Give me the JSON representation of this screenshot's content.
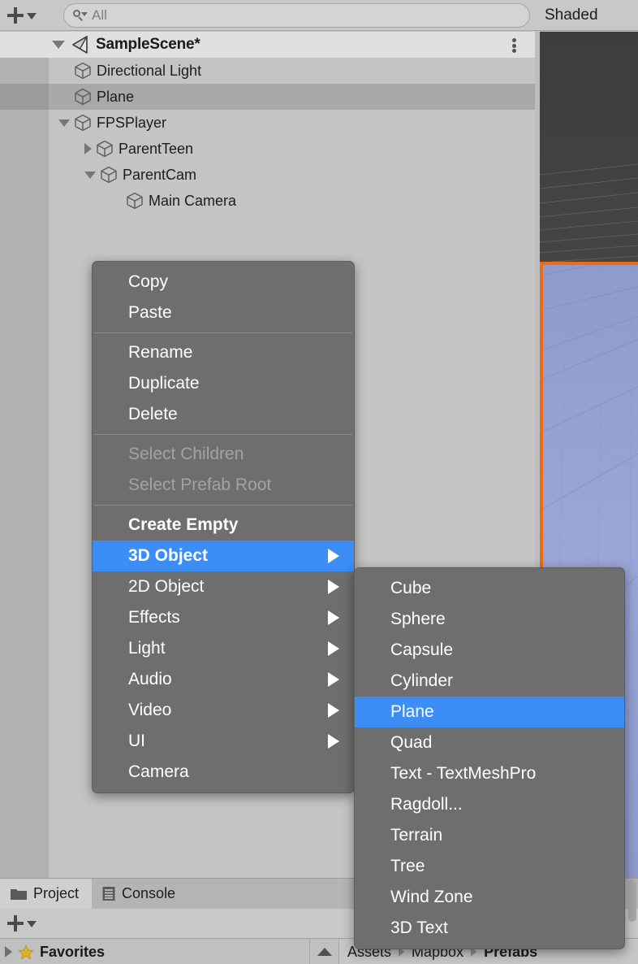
{
  "app": "Unity Editor",
  "hierarchy": {
    "toolbar": {
      "add_label": "+",
      "add_dropdown_icon": "chevron-down-icon",
      "search_icon": "search-icon",
      "search_value": "All",
      "search_placeholder": "All"
    },
    "scene": {
      "name": "SampleScene*",
      "icon": "unity-scene-icon",
      "expanded": true,
      "options_icon": "kebab-menu-icon"
    },
    "items": [
      {
        "label": "Directional Light",
        "depth": 1,
        "foldout": "none",
        "icon": "gameobject-cube-icon",
        "selected": false,
        "zebra": false
      },
      {
        "label": "Plane",
        "depth": 1,
        "foldout": "none",
        "icon": "gameobject-cube-icon",
        "selected": true,
        "zebra": false
      },
      {
        "label": "FPSPlayer",
        "depth": 1,
        "foldout": "open",
        "icon": "gameobject-cube-icon",
        "selected": false,
        "zebra": false
      },
      {
        "label": "ParentTeen",
        "depth": 2,
        "foldout": "closed",
        "icon": "gameobject-cube-icon",
        "selected": false,
        "zebra": false
      },
      {
        "label": "ParentCam",
        "depth": 2,
        "foldout": "open",
        "icon": "gameobject-cube-icon",
        "selected": false,
        "zebra": false
      },
      {
        "label": "Main Camera",
        "depth": 3,
        "foldout": "none",
        "icon": "gameobject-cube-icon",
        "selected": false,
        "zebra": false
      }
    ]
  },
  "scene_view": {
    "shading_mode": "Shaded",
    "sky_color": "#3c3c3c",
    "ground_color": "#93a0d2",
    "selection_outline_color": "#ef6a18"
  },
  "context_menu": {
    "groups": [
      {
        "items": [
          {
            "label": "Copy",
            "disabled": false,
            "submenu": false,
            "highlight": false,
            "bold": false
          },
          {
            "label": "Paste",
            "disabled": false,
            "submenu": false,
            "highlight": false,
            "bold": false
          }
        ]
      },
      {
        "items": [
          {
            "label": "Rename",
            "disabled": false,
            "submenu": false,
            "highlight": false,
            "bold": false
          },
          {
            "label": "Duplicate",
            "disabled": false,
            "submenu": false,
            "highlight": false,
            "bold": false
          },
          {
            "label": "Delete",
            "disabled": false,
            "submenu": false,
            "highlight": false,
            "bold": false
          }
        ]
      },
      {
        "items": [
          {
            "label": "Select Children",
            "disabled": true,
            "submenu": false,
            "highlight": false,
            "bold": false
          },
          {
            "label": "Select Prefab Root",
            "disabled": true,
            "submenu": false,
            "highlight": false,
            "bold": false
          }
        ]
      },
      {
        "items": [
          {
            "label": "Create Empty",
            "disabled": false,
            "submenu": false,
            "highlight": false,
            "bold": true
          },
          {
            "label": "3D Object",
            "disabled": false,
            "submenu": true,
            "highlight": true,
            "bold": true
          },
          {
            "label": "2D Object",
            "disabled": false,
            "submenu": true,
            "highlight": false,
            "bold": false
          },
          {
            "label": "Effects",
            "disabled": false,
            "submenu": true,
            "highlight": false,
            "bold": false
          },
          {
            "label": "Light",
            "disabled": false,
            "submenu": true,
            "highlight": false,
            "bold": false
          },
          {
            "label": "Audio",
            "disabled": false,
            "submenu": true,
            "highlight": false,
            "bold": false
          },
          {
            "label": "Video",
            "disabled": false,
            "submenu": true,
            "highlight": false,
            "bold": false
          },
          {
            "label": "UI",
            "disabled": false,
            "submenu": true,
            "highlight": false,
            "bold": false
          },
          {
            "label": "Camera",
            "disabled": false,
            "submenu": false,
            "highlight": false,
            "bold": false
          }
        ]
      }
    ],
    "highlight_color": "#3c8ef5"
  },
  "submenu_3d_object": {
    "items": [
      {
        "label": "Cube",
        "highlight": false
      },
      {
        "label": "Sphere",
        "highlight": false
      },
      {
        "label": "Capsule",
        "highlight": false
      },
      {
        "label": "Cylinder",
        "highlight": false
      },
      {
        "label": "Plane",
        "highlight": true
      },
      {
        "label": "Quad",
        "highlight": false
      },
      {
        "label": "Text - TextMeshPro",
        "highlight": false
      },
      {
        "label": "Ragdoll...",
        "highlight": false
      },
      {
        "label": "Terrain",
        "highlight": false
      },
      {
        "label": "Tree",
        "highlight": false
      },
      {
        "label": "Wind Zone",
        "highlight": false
      },
      {
        "label": "3D Text",
        "highlight": false
      }
    ]
  },
  "project_panel": {
    "tabs": [
      {
        "label": "Project",
        "icon": "folder-icon",
        "active": true
      },
      {
        "label": "Console",
        "icon": "console-icon",
        "active": false
      }
    ],
    "toolbar": {
      "add_label": "+",
      "add_dropdown_icon": "chevron-down-icon"
    },
    "favorites": {
      "label": "Favorites",
      "icon": "star-icon",
      "foldout": "closed"
    },
    "breadcrumb": [
      "Assets",
      "Mapbox",
      "Prefabs"
    ],
    "scroll_up_icon": "triangle-up-icon"
  }
}
